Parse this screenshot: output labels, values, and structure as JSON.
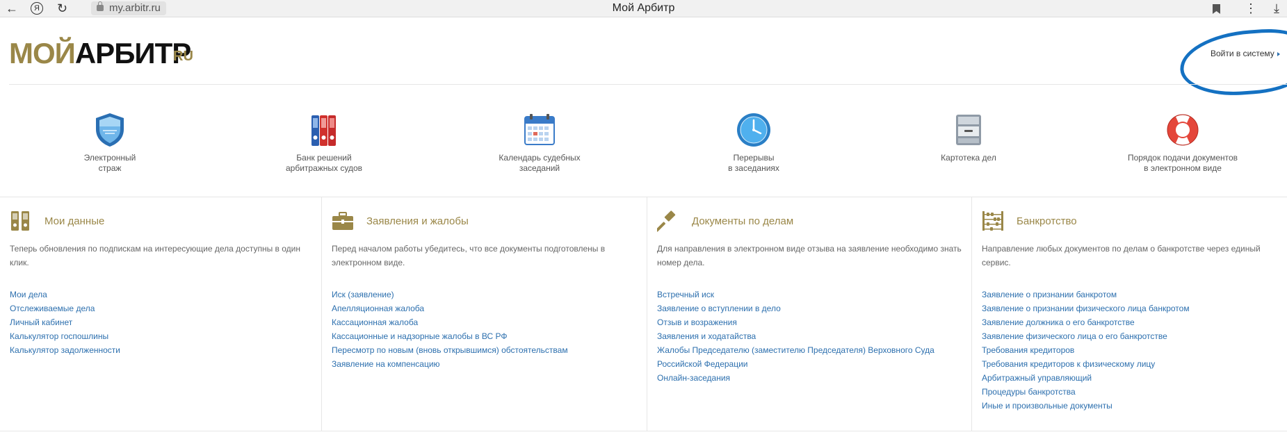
{
  "browser": {
    "url": "my.arbitr.ru",
    "tab_title": "Мой Арбитр"
  },
  "header": {
    "logo_part1": "МОЙ",
    "logo_part2": "АРБИТР",
    "logo_suffix": "RU",
    "login": "Войти в систему"
  },
  "services": [
    {
      "line1": "Электронный",
      "line2": "страж",
      "icon": "shield-icon"
    },
    {
      "line1": "Банк решений",
      "line2": "арбитражных судов",
      "icon": "binders-icon"
    },
    {
      "line1": "Календарь судебных",
      "line2": "заседаний",
      "icon": "calendar-icon"
    },
    {
      "line1": "Перерывы",
      "line2": "в заседаниях",
      "icon": "clock-icon"
    },
    {
      "line1": "Картотека дел",
      "line2": "",
      "icon": "cabinet-icon"
    },
    {
      "line1": "Порядок подачи документов",
      "line2": "в электронном виде",
      "icon": "lifebuoy-icon"
    }
  ],
  "columns": [
    {
      "title": "Мои данные",
      "icon": "binders-icon",
      "desc": "Теперь обновления по подпискам на интересующие дела доступны в один клик.",
      "links": [
        "Мои дела",
        "Отслеживаемые дела",
        "Личный кабинет",
        "Калькулятор госпошлины",
        "Калькулятор задолженности"
      ]
    },
    {
      "title": "Заявления и жалобы",
      "icon": "briefcase-icon",
      "desc": "Перед началом работы убедитесь, что все документы подготовлены в электронном виде.",
      "links": [
        "Иск (заявление)",
        "Апелляционная жалоба",
        "Кассационная жалоба",
        "Кассационные и надзорные жалобы в ВС РФ",
        "Пересмотр по новым (вновь открывшимся) обстоятельствам",
        "Заявление на компенсацию"
      ]
    },
    {
      "title": "Документы по делам",
      "icon": "gavel-icon",
      "desc": "Для направления в электронном виде отзыва на заявление необходимо знать номер дела.",
      "links": [
        "Встречный иск",
        "Заявление о вступлении в дело",
        "Отзыв и возражения",
        "Заявления и ходатайства",
        "Жалобы Председателю (заместителю Председателя) Верховного Суда",
        "Российской Федерации",
        "Онлайн-заседания"
      ]
    },
    {
      "title": "Банкротство",
      "icon": "abacus-icon",
      "desc": "Направление любых документов по делам о банкротстве через единый сервис.",
      "links": [
        "Заявление о признании банкротом",
        "Заявление о признании физического лица банкротом",
        "Заявление должника о его банкротстве",
        "Заявление физического лица о его банкротстве",
        "Требования кредиторов",
        "Требования кредиторов к физическому лицу",
        "Арбитражный управляющий",
        "Процедуры банкротства",
        "Иные и произвольные документы"
      ]
    }
  ],
  "colors": {
    "gold": "#9a8748",
    "link": "#2c6fae",
    "annotation": "#1471c2"
  }
}
